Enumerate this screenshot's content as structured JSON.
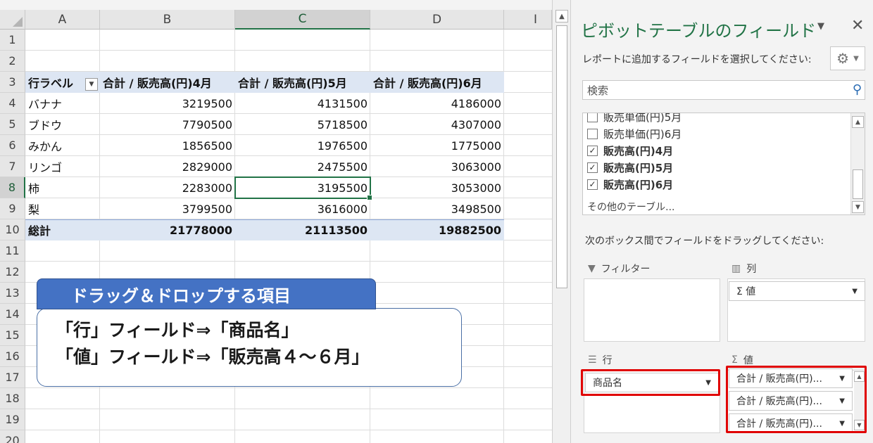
{
  "sheet": {
    "columns": [
      {
        "letter": "A"
      },
      {
        "letter": "B"
      },
      {
        "letter": "C"
      },
      {
        "letter": "D"
      },
      {
        "letter": "I"
      }
    ],
    "selected_column": "C",
    "rows": [
      "1",
      "2",
      "3",
      "4",
      "5",
      "6",
      "7",
      "8",
      "9",
      "10",
      "11",
      "12",
      "13",
      "14",
      "15",
      "16",
      "17",
      "18",
      "19",
      "20"
    ],
    "selected_row": "8",
    "pivot": {
      "headers": [
        "行ラベル",
        "合計 / 販売高(円)4月",
        "合計 / 販売高(円)5月",
        "合計 / 販売高(円)6月"
      ],
      "data": [
        [
          "バナナ",
          "3219500",
          "4131500",
          "4186000"
        ],
        [
          "ブドウ",
          "7790500",
          "5718500",
          "4307000"
        ],
        [
          "みかん",
          "1856500",
          "1976500",
          "1775000"
        ],
        [
          "リンゴ",
          "2829000",
          "2475500",
          "3063000"
        ],
        [
          "柿",
          "2283000",
          "3195500",
          "3053000"
        ],
        [
          "梨",
          "3799500",
          "3616000",
          "3498500"
        ]
      ],
      "total": [
        "総計",
        "21778000",
        "21113500",
        "19882500"
      ]
    }
  },
  "callout": {
    "title": "ドラッグ＆ドロップする項目",
    "line1": "「行」フィールド⇒「商品名」",
    "line2": "「値」フィールド⇒「販売高４～６月」"
  },
  "pane": {
    "title": "ピボットテーブルのフィールド",
    "subtitle": "レポートに追加するフィールドを選択してください:",
    "search_placeholder": "検索",
    "fields": [
      {
        "label": "販売単価(円)5月",
        "checked": false,
        "bold": false
      },
      {
        "label": "販売単価(円)6月",
        "checked": false,
        "bold": false
      },
      {
        "label": "販売高(円)4月",
        "checked": true,
        "bold": true
      },
      {
        "label": "販売高(円)5月",
        "checked": true,
        "bold": true
      },
      {
        "label": "販売高(円)6月",
        "checked": true,
        "bold": true
      }
    ],
    "other_tables": "その他のテーブル...",
    "drag_hint": "次のボックス間でフィールドをドラッグしてください:",
    "areas": {
      "filter": "フィルター",
      "columns": "列",
      "rows": "行",
      "values": "値"
    },
    "column_items": [
      "Σ 値"
    ],
    "row_items": [
      "商品名"
    ],
    "value_items": [
      "合計 / 販売高(円)...",
      "合計 / 販売高(円)...",
      "合計 / 販売高(円)..."
    ],
    "accent": "#217346",
    "highlight": "#e00000"
  }
}
